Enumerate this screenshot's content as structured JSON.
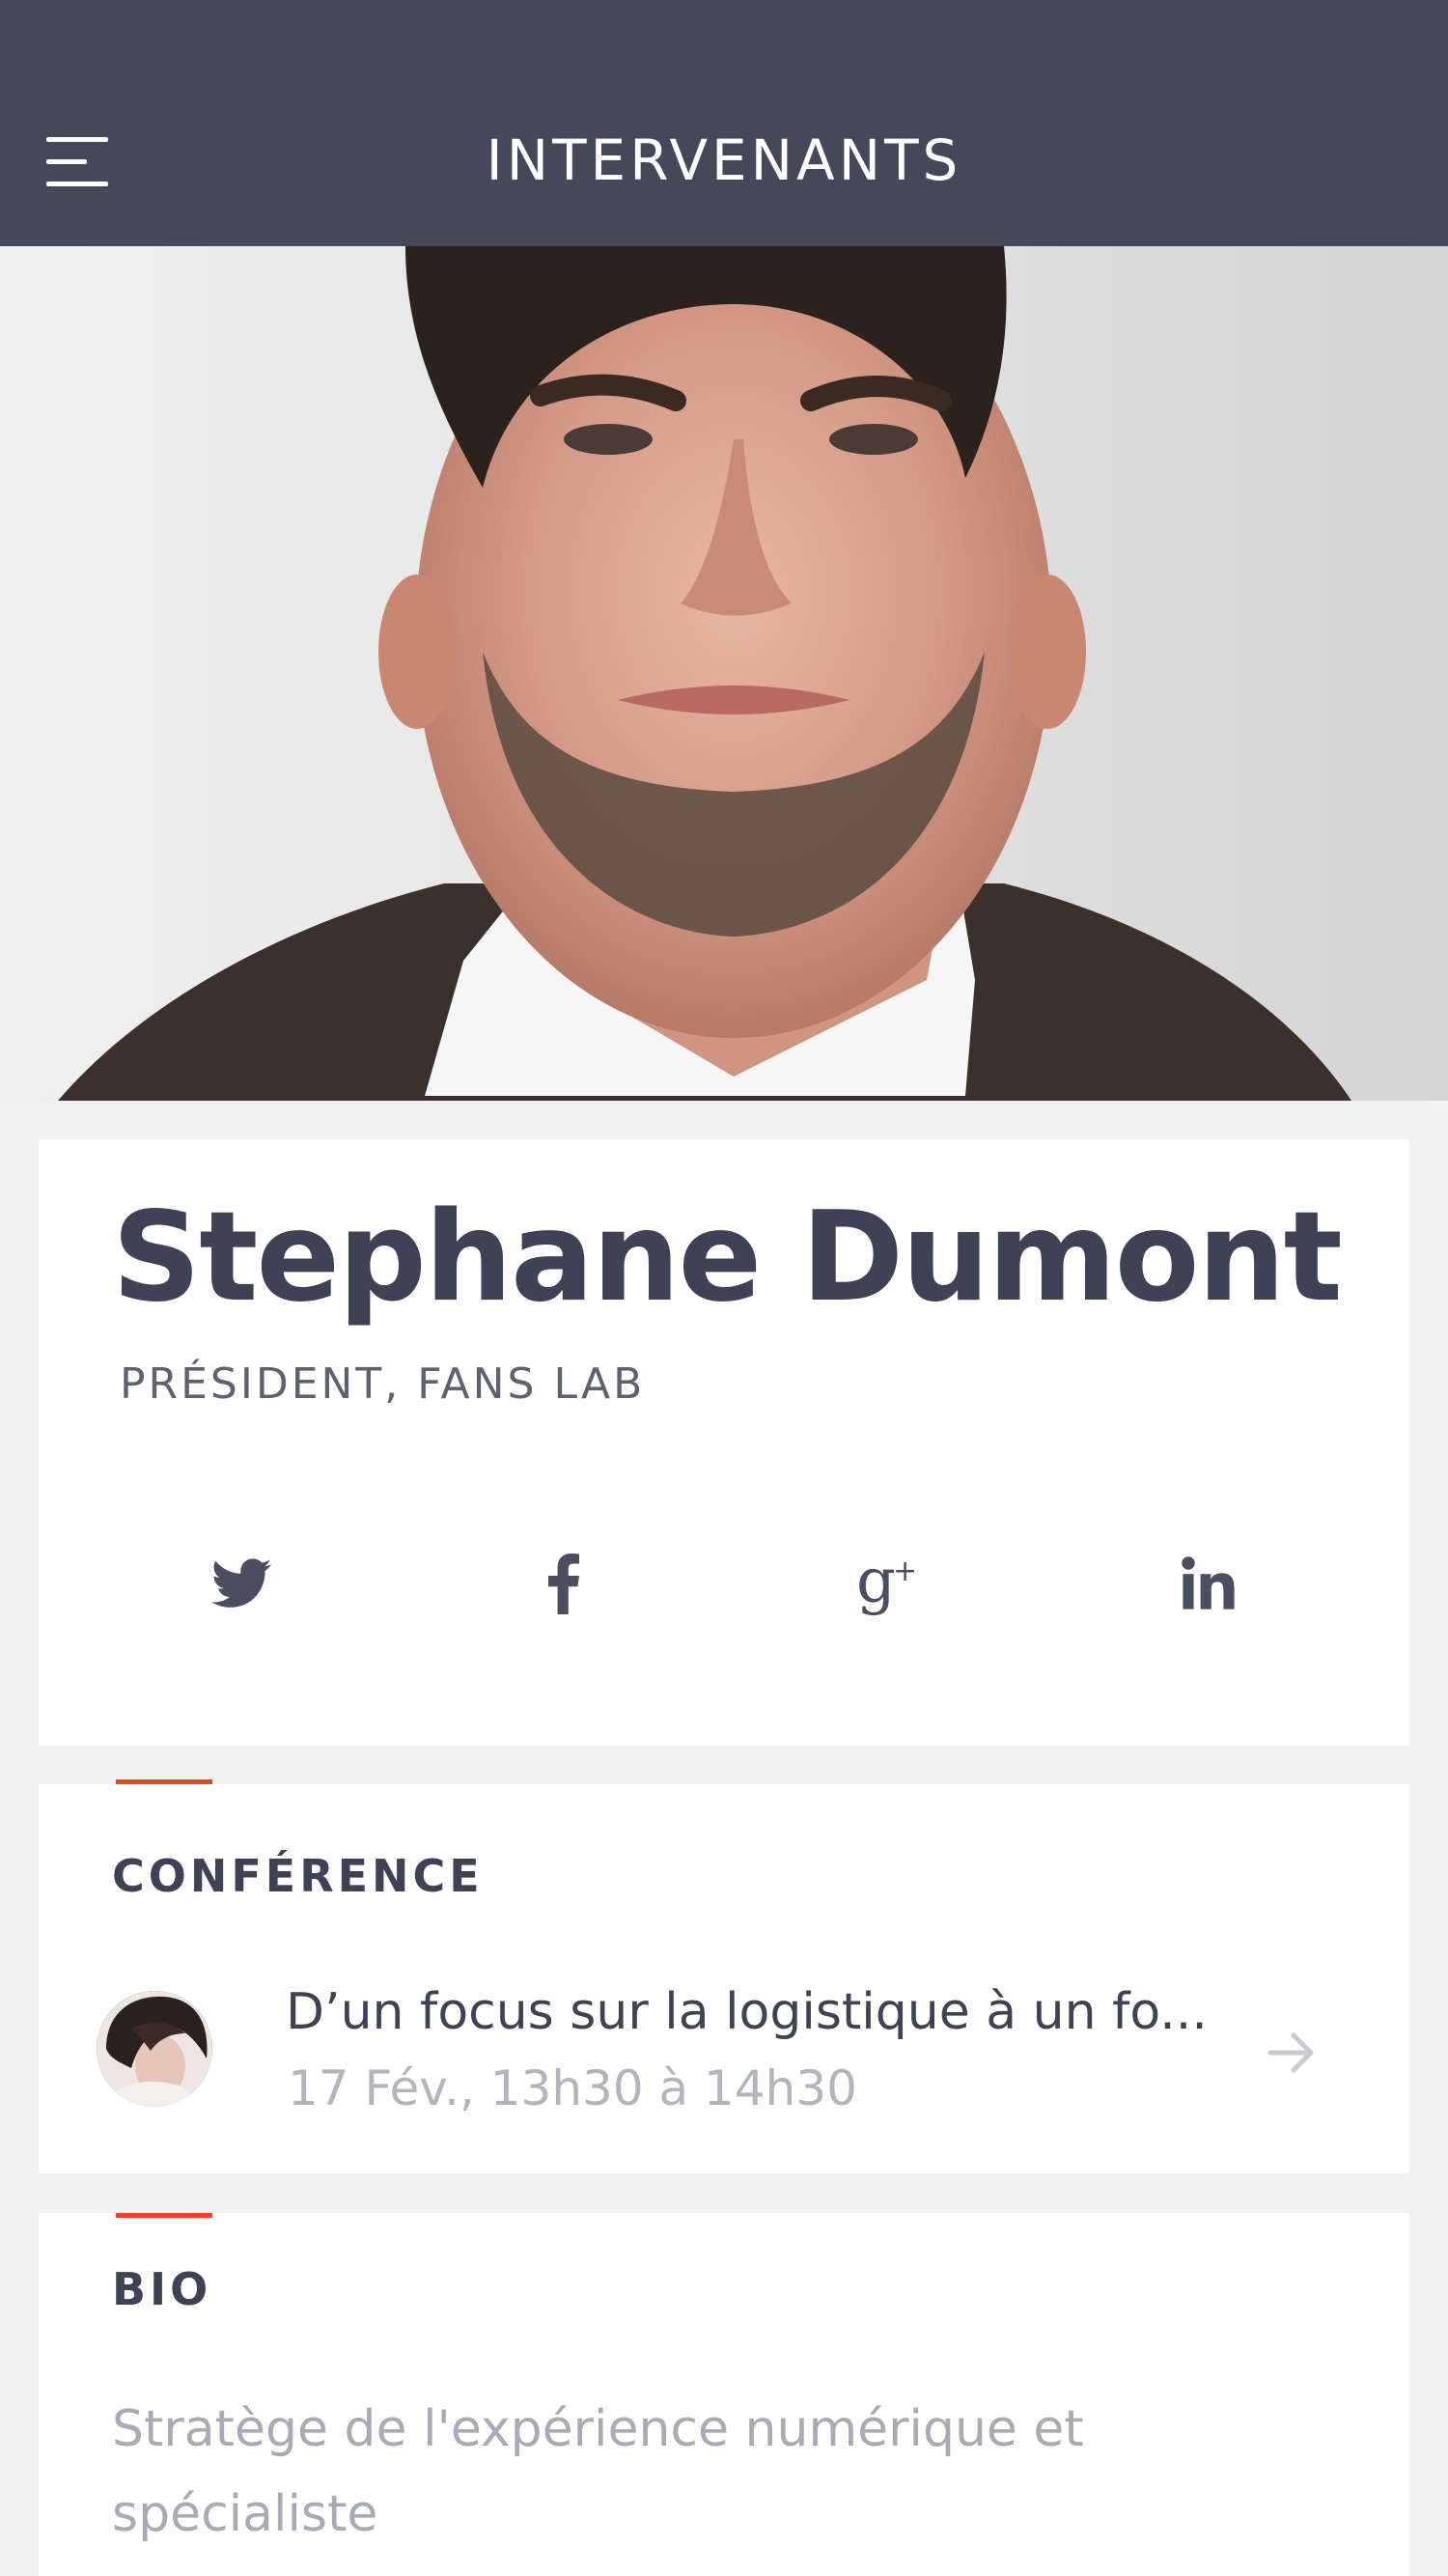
{
  "header": {
    "title": "INTERVENANTS",
    "menu_icon": "hamburger-menu-icon",
    "background": "#444858"
  },
  "speaker": {
    "name": "Stephane Dumont",
    "role": "PRÉSIDENT, FANS LAB",
    "photo": "speaker-portrait"
  },
  "socials": [
    {
      "icon": "twitter-icon"
    },
    {
      "icon": "facebook-icon"
    },
    {
      "icon": "google-plus-icon"
    },
    {
      "icon": "linkedin-icon"
    }
  ],
  "conference": {
    "label": "CONFÉRENCE",
    "session": {
      "title": "D’un focus sur la logistique à un fo...",
      "time": "17 Fév., 13h30 à 14h30",
      "arrow_icon": "arrow-right-icon"
    }
  },
  "bio": {
    "label": "BIO",
    "text": "Stratège de l'expérience numérique et spécialiste"
  },
  "colors": {
    "accent": "#e8462b",
    "text_dark": "#3e4254",
    "text_muted": "#b3b5bd",
    "page_background": "#f1f1f2"
  }
}
